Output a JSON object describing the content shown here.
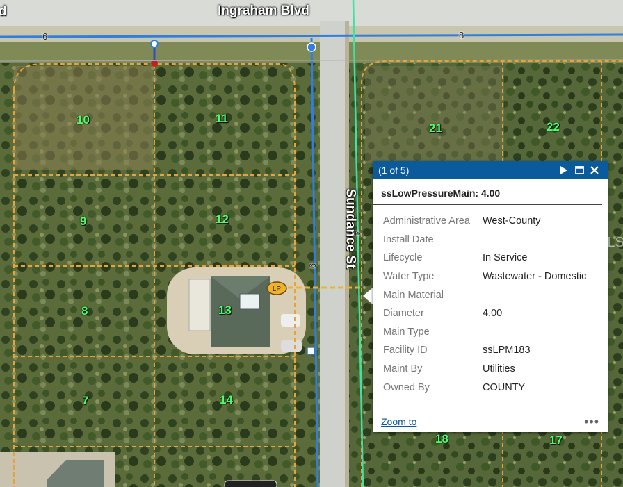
{
  "map": {
    "street_names": {
      "ingraham": "Ingraham Blvd",
      "sundance": "Sundance St"
    },
    "partial_top_left_label": "d",
    "segment_labels": [
      "6",
      "8",
      "9",
      "4"
    ],
    "lots": [
      "10",
      "11",
      "9",
      "12",
      "8",
      "13",
      "7",
      "14",
      "21",
      "22",
      "18",
      "17"
    ],
    "lp_badge": "LP",
    "watermark": "StellarMLS",
    "colors": {
      "main_line": "#2f7ee0",
      "property_line": "#e8a23c",
      "pressure_main": "#f0b22a",
      "green_line": "#3de3a0",
      "lot_label": "#4cff6a"
    }
  },
  "popup": {
    "counter": "(1 of 5)",
    "title": "ssLowPressureMain: 4.00",
    "attributes": [
      {
        "key": "Administrative Area",
        "value": "West-County"
      },
      {
        "key": "Install Date",
        "value": ""
      },
      {
        "key": "Lifecycle",
        "value": "In Service"
      },
      {
        "key": "Water Type",
        "value": "Wastewater - Domestic"
      },
      {
        "key": "Main Material",
        "value": ""
      },
      {
        "key": "Diameter",
        "value": "4.00"
      },
      {
        "key": "Main Type",
        "value": ""
      },
      {
        "key": "Facility ID",
        "value": "ssLPM183"
      },
      {
        "key": "Maint By",
        "value": "Utilities"
      },
      {
        "key": "Owned By",
        "value": "COUNTY"
      }
    ],
    "zoom_label": "Zoom to",
    "more_label": "•••",
    "header_color": "#0a5a9c"
  }
}
